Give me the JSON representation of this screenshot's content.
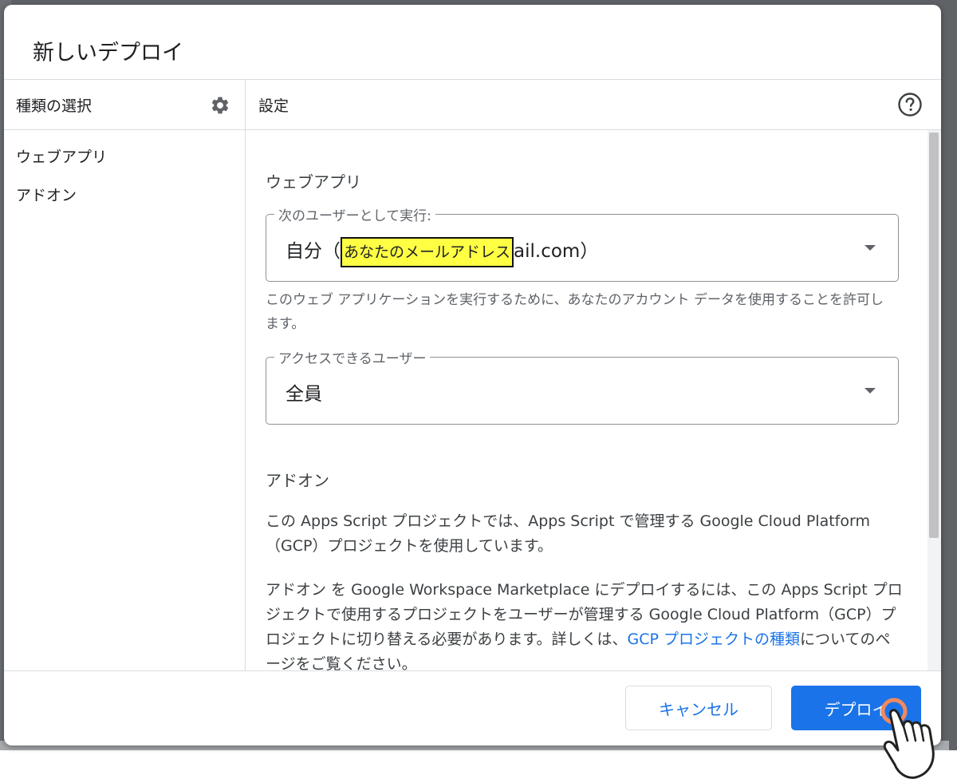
{
  "dialog": {
    "title": "新しいデプロイ"
  },
  "left_panel": {
    "header": "種類の選択",
    "items": [
      {
        "label": "ウェブアプリ"
      },
      {
        "label": "アドオン"
      }
    ]
  },
  "right_panel": {
    "header": "設定",
    "web_app": {
      "title": "ウェブアプリ",
      "execute_as": {
        "label": "次のユーザーとして実行:",
        "value_prefix": "自分（",
        "highlight": "あなたのメールアドレス",
        "value_suffix": "ail.com）"
      },
      "execute_help": "このウェブ アプリケーションを実行するために、あなたのアカウント データを使用することを許可します。",
      "access": {
        "label": "アクセスできるユーザー",
        "value": "全員"
      }
    },
    "addon": {
      "title": "アドオン",
      "para1": "この Apps Script プロジェクトでは、Apps Script で管理する Google Cloud Platform（GCP）プロジェクトを使用しています。",
      "para2_text": "アドオン を Google Workspace Marketplace にデプロイするには、この Apps Script プロジェクトで使用するプロジェクトをユーザーが管理する Google Cloud Platform（GCP）プロジェクトに切り替える必要があります。詳しくは、",
      "para2_link": "GCP プロジェクトの種類",
      "para2_tail": "についてのページをご覧ください。"
    }
  },
  "footer": {
    "cancel_label": "キャンセル",
    "deploy_label": "デプロイ"
  },
  "colors": {
    "accent": "#1a73e8",
    "highlight": "#ffff44"
  },
  "icons": [
    "gear-icon",
    "help-icon",
    "dropdown-arrow-icon",
    "pointer-hand-icon"
  ]
}
